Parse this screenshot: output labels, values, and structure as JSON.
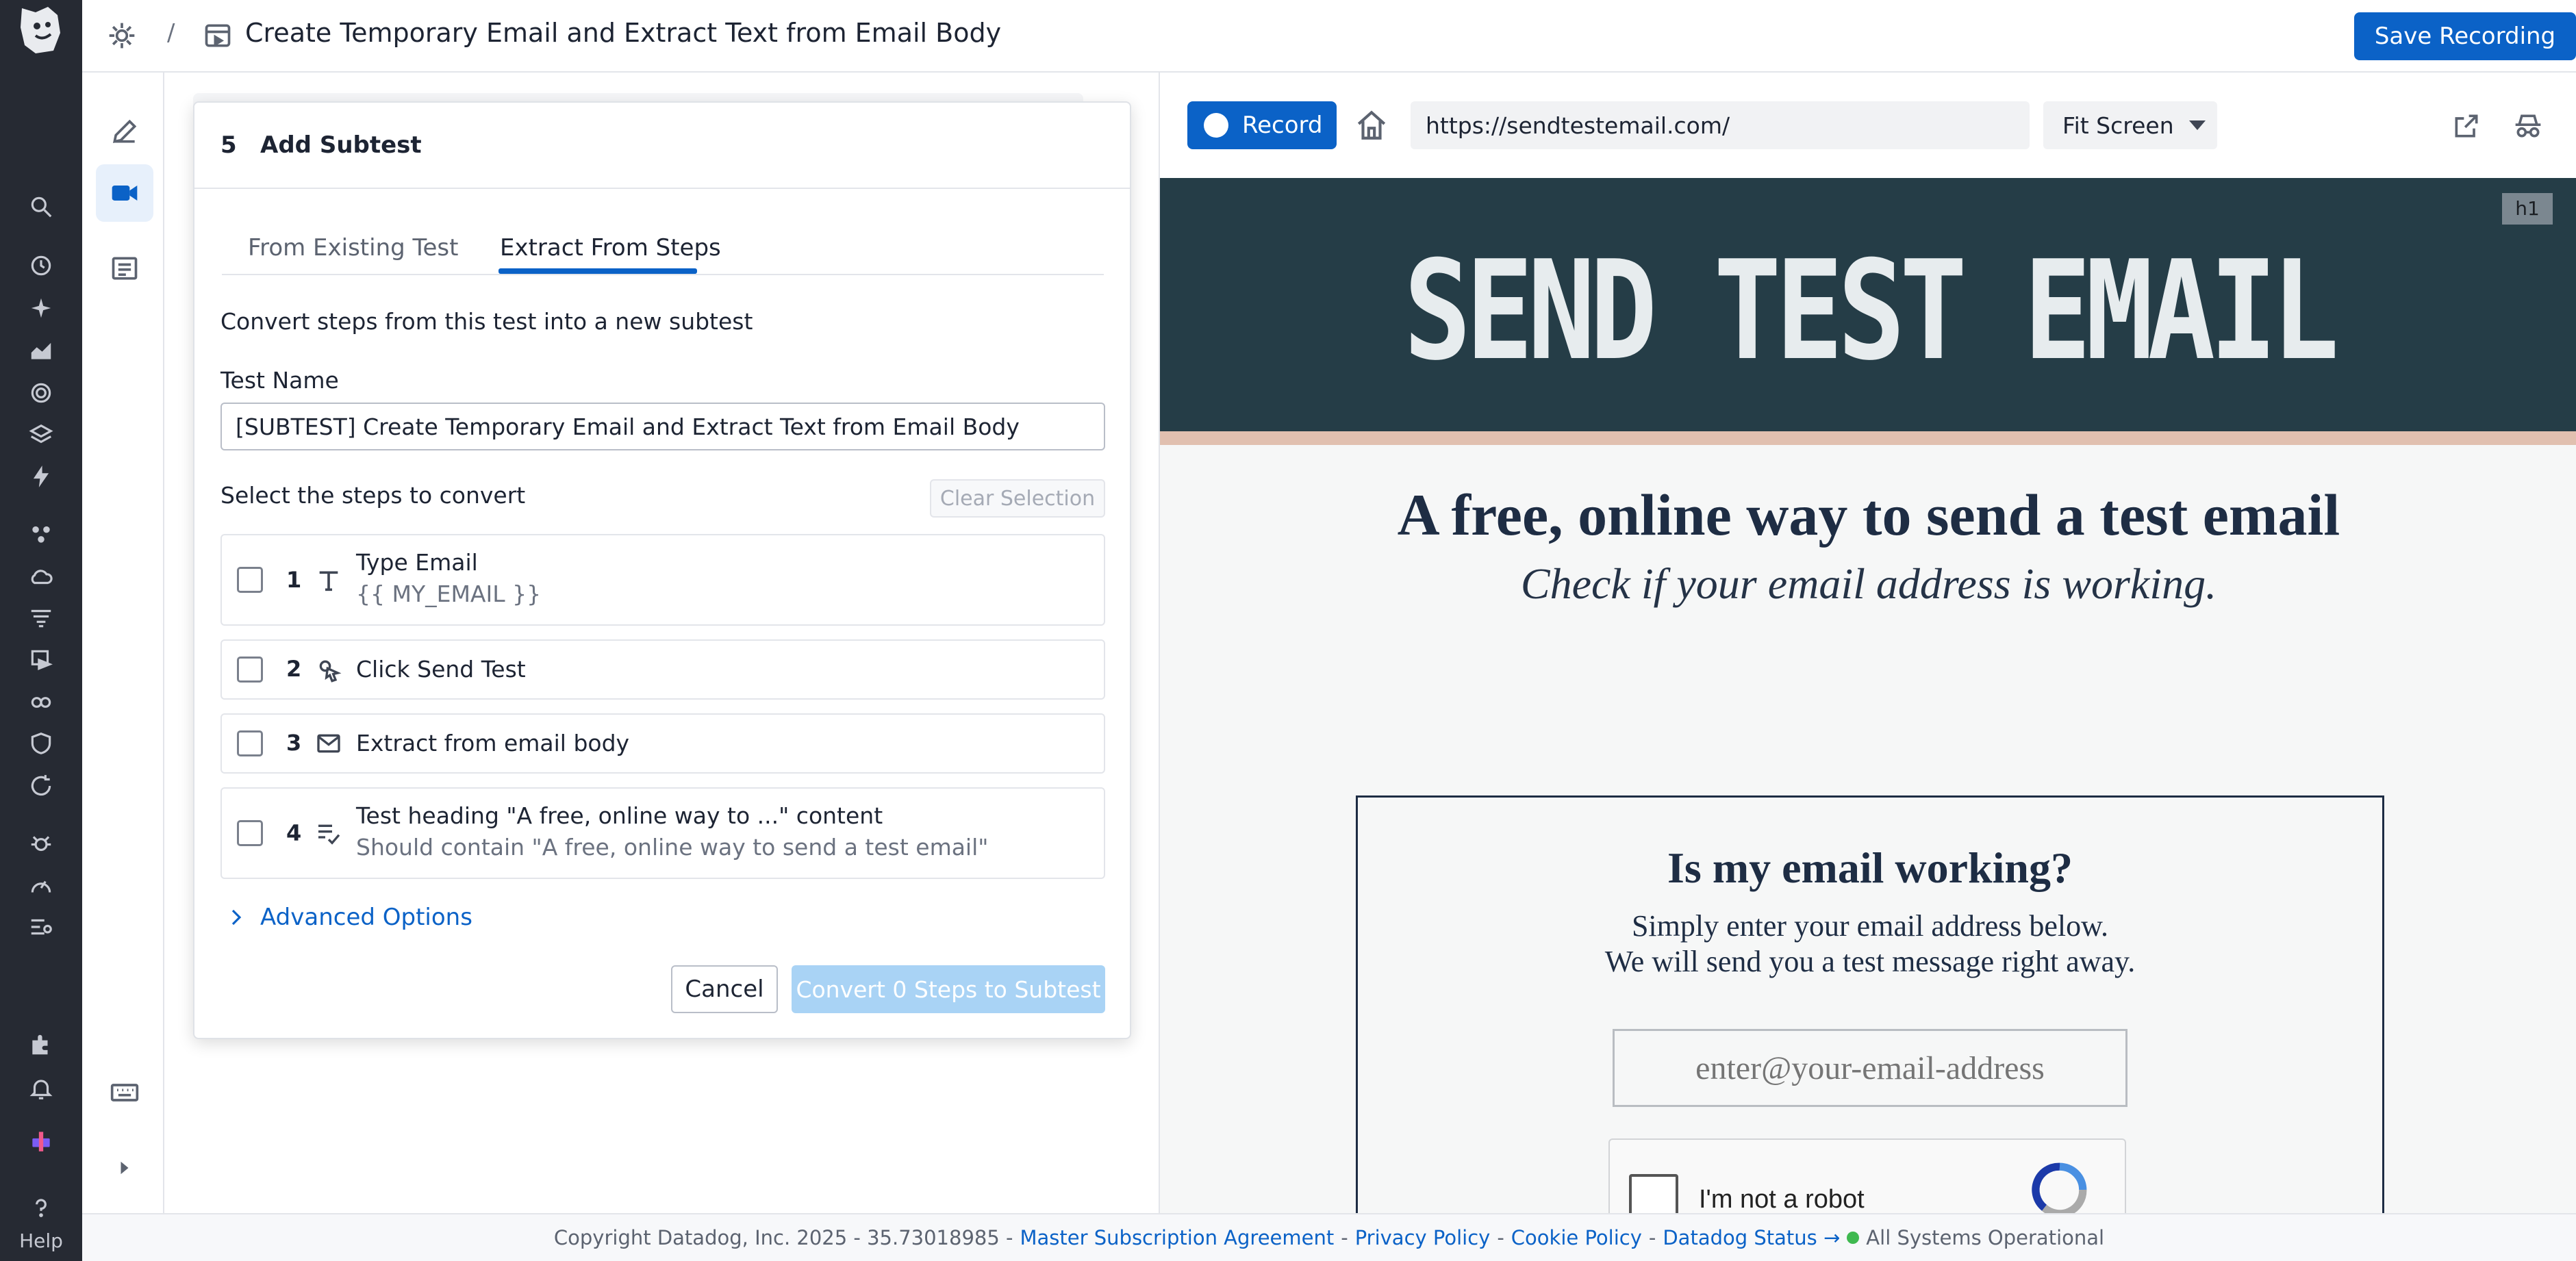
{
  "header": {
    "separator": "/",
    "title": "Create Temporary Email and Extract Text from Email Body",
    "save_label": "Save Recording"
  },
  "global_nav": {
    "icons": [
      "search-icon",
      "history-icon",
      "sparkle-icon",
      "chart-icon",
      "target-icon",
      "layers-icon",
      "bolt-icon",
      "apps-icon",
      "cloud-icon",
      "filter-list-icon",
      "synthetics-icon",
      "link-icon",
      "shield-icon",
      "refresh-icon",
      "bug-icon",
      "gauge-icon",
      "logs-icon",
      "puzzle-icon",
      "bell-icon",
      "product-icon",
      "help-icon"
    ],
    "help_label": "Help"
  },
  "modal": {
    "step_number": "5",
    "title": "Add Subtest",
    "tabs": [
      {
        "label": "From Existing Test"
      },
      {
        "label": "Extract From Steps"
      }
    ],
    "description": "Convert steps from this test into a new subtest",
    "test_name_label": "Test Name",
    "test_name_value": "[SUBTEST] Create Temporary Email and Extract Text from Email Body",
    "select_label": "Select the steps to convert",
    "clear_label": "Clear Selection",
    "steps": [
      {
        "num": "1",
        "title": "Type Email",
        "detail": "{{ MY_EMAIL }}",
        "icon": "text-type-icon"
      },
      {
        "num": "2",
        "title": "Click Send Test",
        "detail": "",
        "icon": "click-icon"
      },
      {
        "num": "3",
        "title": "Extract from email body",
        "detail": "",
        "icon": "mail-icon"
      },
      {
        "num": "4",
        "title": "Test heading \"A free, online way to ...\" content",
        "detail": "Should contain \"A free, online way to send a test email\"",
        "icon": "assertion-icon"
      }
    ],
    "advanced_label": "Advanced Options",
    "cancel_label": "Cancel",
    "convert_label": "Convert 0 Steps to Subtest"
  },
  "browser": {
    "record_label": "Record",
    "url": "https://sendtestemail.com/",
    "fit_label": "Fit Screen"
  },
  "site": {
    "banner_title": "SEND TEST EMAIL",
    "tag": "h1",
    "headline": "A free, online way to send a test email",
    "subheadline": "Check if your email address is working.",
    "box_title": "Is my email working?",
    "box_line1": "Simply enter your email address below.",
    "box_line2": "We will send you a test message right away.",
    "email_placeholder": "enter@your-email-address",
    "captcha_label": "I'm not a robot"
  },
  "footer": {
    "copyright": "Copyright Datadog, Inc. 2025 - 35.73018985 -",
    "links": [
      "Master Subscription Agreement",
      "Privacy Policy",
      "Cookie Policy",
      "Datadog Status →"
    ],
    "dash": "-",
    "status": "All Systems Operational"
  },
  "colors": {
    "primary": "#0b62c7",
    "nav_bg": "#262a33",
    "banner_bg": "#253d47",
    "status_ok": "#3fb950"
  }
}
